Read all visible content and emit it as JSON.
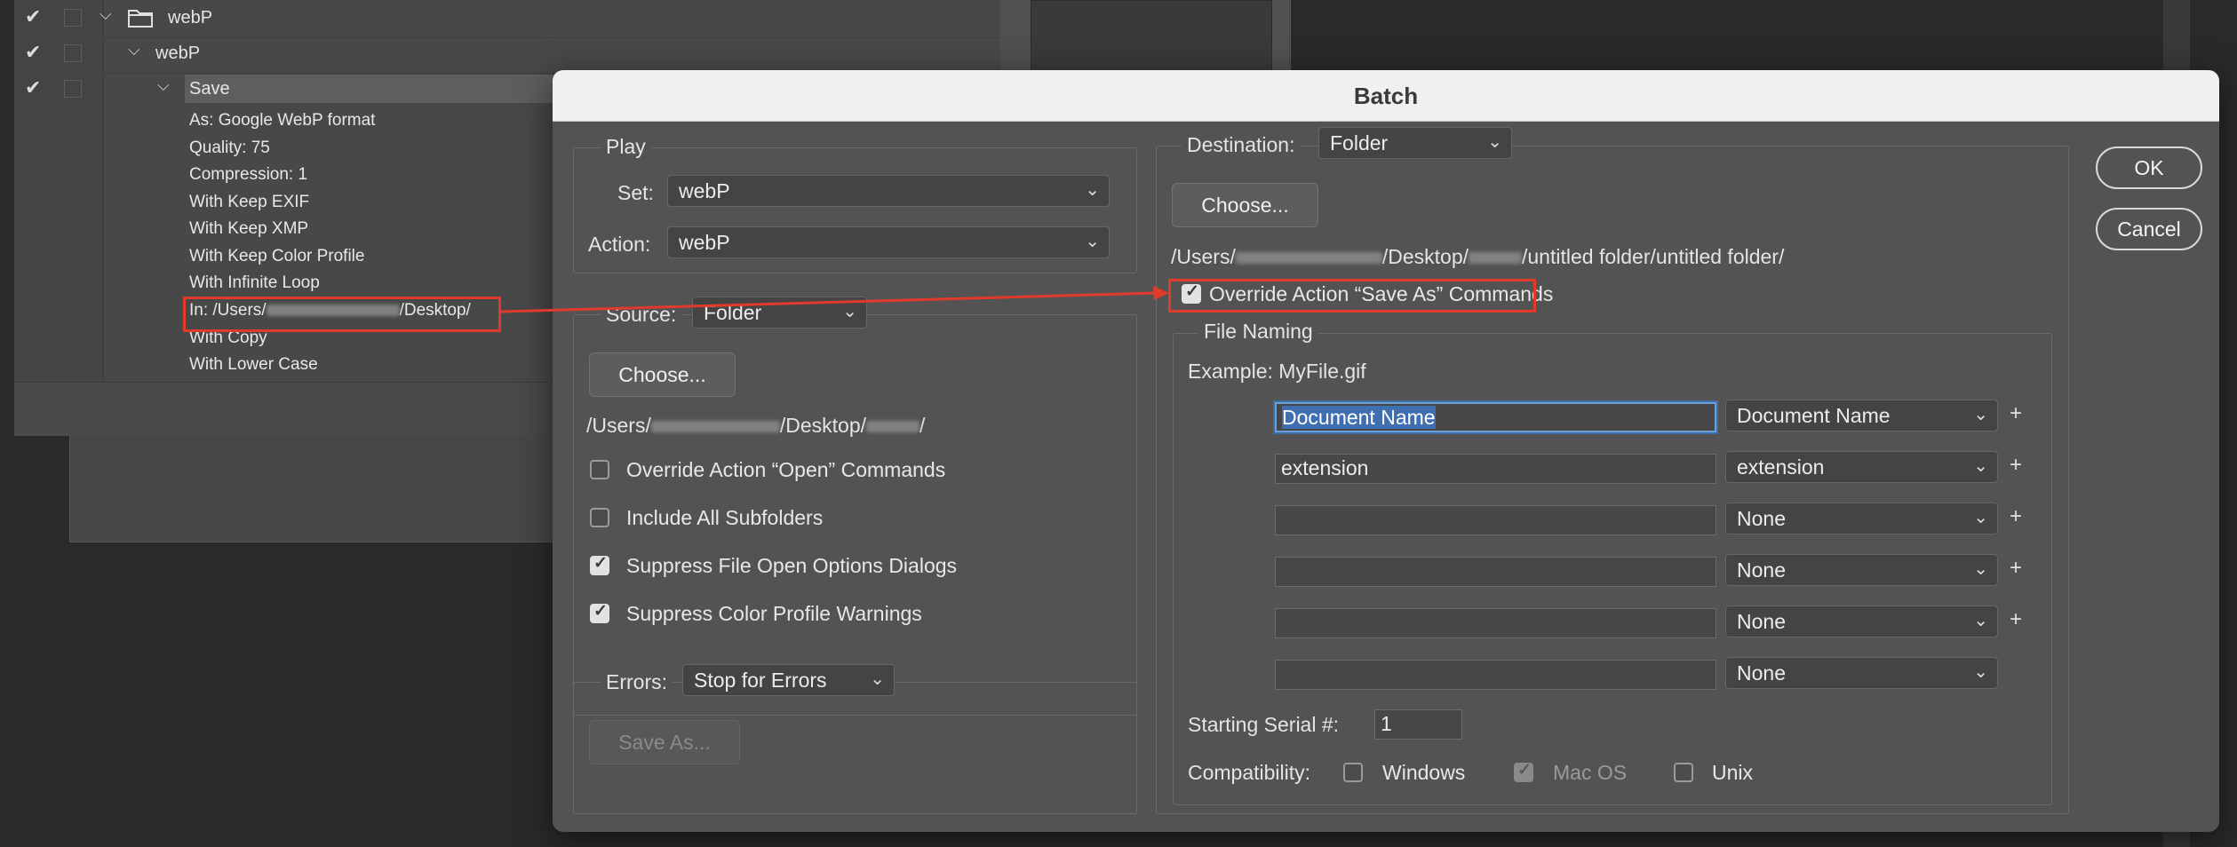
{
  "actions_panel": {
    "rows": [
      {
        "label": "webP",
        "kind": "set"
      },
      {
        "label": "webP",
        "kind": "action"
      },
      {
        "label": "Save",
        "kind": "step"
      }
    ],
    "step_details": [
      "As: Google WebP format",
      "Quality: 75",
      "Compression: 1",
      "With Keep EXIF",
      "With Keep XMP",
      "With Keep Color Profile",
      "With Infinite Loop",
      "In: /Users/",
      "With Copy",
      "With Lower Case"
    ],
    "in_path_suffix": "/Desktop/"
  },
  "dialog": {
    "title": "Batch",
    "ok_label": "OK",
    "cancel_label": "Cancel",
    "play": {
      "legend": "Play",
      "set_label": "Set:",
      "set_value": "webP",
      "action_label": "Action:",
      "action_value": "webP"
    },
    "source": {
      "label": "Source:",
      "value": "Folder",
      "choose_label": "Choose...",
      "path_prefix": "/Users/",
      "path_mid": "/Desktop/",
      "path_end": "/",
      "options": [
        {
          "label": "Override Action “Open” Commands",
          "checked": false
        },
        {
          "label": "Include All Subfolders",
          "checked": false
        },
        {
          "label": "Suppress File Open Options Dialogs",
          "checked": true
        },
        {
          "label": "Suppress Color Profile Warnings",
          "checked": true
        }
      ]
    },
    "errors": {
      "label": "Errors:",
      "value": "Stop for Errors",
      "save_as_label": "Save As..."
    },
    "destination": {
      "label": "Destination:",
      "value": "Folder",
      "choose_label": "Choose...",
      "path_prefix": "/Users/",
      "path_mid": "/Desktop/",
      "path_end": "/untitled folder/untitled folder/",
      "override_label": "Override Action “Save As” Commands",
      "override_checked": true
    },
    "file_naming": {
      "legend": "File Naming",
      "example": "Example: MyFile.gif",
      "rows": [
        {
          "field": "Document Name",
          "select": "Document Name",
          "plus": "+"
        },
        {
          "field": "extension",
          "select": "extension",
          "plus": "+"
        },
        {
          "field": "",
          "select": "None",
          "plus": "+"
        },
        {
          "field": "",
          "select": "None",
          "plus": "+"
        },
        {
          "field": "",
          "select": "None",
          "plus": "+"
        },
        {
          "field": "",
          "select": "None",
          "plus": ""
        }
      ],
      "serial_label": "Starting Serial #:",
      "serial_value": "1",
      "compat_label": "Compatibility:",
      "compat": [
        {
          "label": "Windows",
          "checked": false,
          "disabled": false
        },
        {
          "label": "Mac OS",
          "checked": true,
          "disabled": true
        },
        {
          "label": "Unix",
          "checked": false,
          "disabled": false
        }
      ]
    }
  },
  "colors": {
    "annotation": "#e03a2a",
    "focus": "#3f6fb0"
  }
}
